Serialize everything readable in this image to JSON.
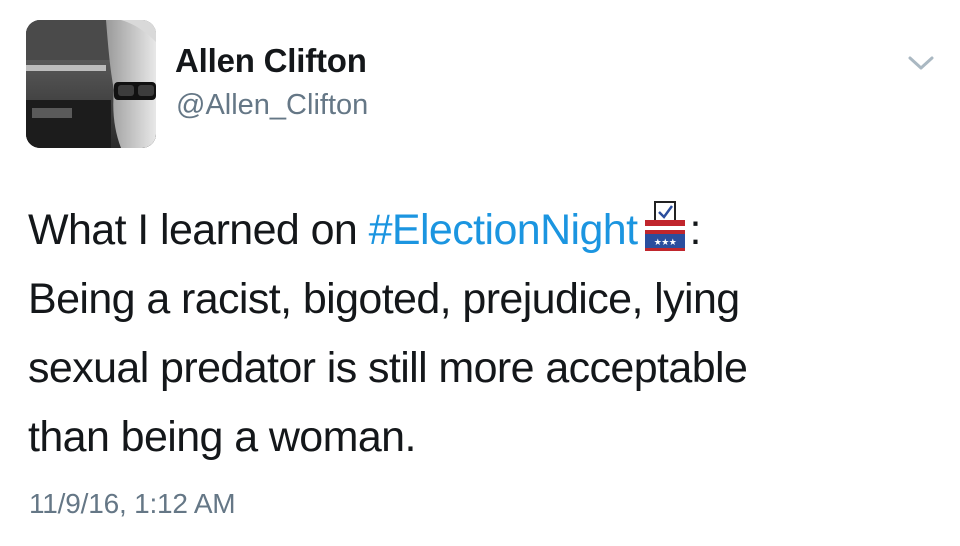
{
  "user": {
    "display_name": "Allen Clifton",
    "handle": "@Allen_Clifton"
  },
  "tweet": {
    "line1_prefix": "What I learned on ",
    "hashtag": "#ElectionNight",
    "line1_suffix": ":",
    "line2": "Being a racist, bigoted, prejudice, lying",
    "line3": "sexual predator is still more acceptable",
    "line4": "than being a woman."
  },
  "timestamp": "11/9/16, 1:12 AM",
  "icons": {
    "menu": "chevron-down-icon",
    "emoji": "ballot-box-icon"
  },
  "colors": {
    "link": "#1b95e0",
    "text": "#14171a",
    "muted": "#657786",
    "emoji_red": "#c0262d",
    "emoji_blue": "#2b4e9e"
  }
}
